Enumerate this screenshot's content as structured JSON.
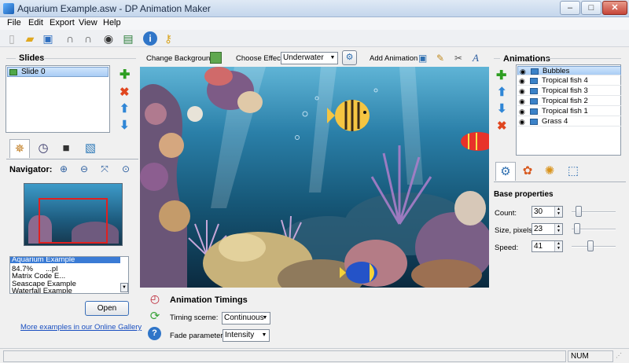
{
  "window": {
    "title": "Aquarium Example.asw - DP Animation Maker",
    "minimize": "–",
    "maximize": "□",
    "close": "✕"
  },
  "menu": [
    "File",
    "Edit",
    "Export",
    "View",
    "Help"
  ],
  "toolbar": {
    "icons": [
      "new-icon",
      "open-folder-icon",
      "save-icon",
      "undo-icon",
      "redo-icon",
      "preview-eye-icon",
      "publish-icon",
      "info-icon",
      "key-icon"
    ]
  },
  "slides": {
    "title": "Slides",
    "items": [
      "Slide 0"
    ]
  },
  "navigator": {
    "label": "Navigator:",
    "zoom": "84.7%",
    "examples": [
      "Aquarium Example",
      "...pl",
      "Matrix Code E...",
      "Seascape Example",
      "Waterfall Example"
    ],
    "open_button": "Open",
    "gallery_link": "More examples in our Online Gallery"
  },
  "canvas_toolbar": {
    "change_background": "Change Background",
    "choose_effect_label": "Choose Effect:",
    "effect_value": "Underwater",
    "add_animation": "Add Animation"
  },
  "timings": {
    "title": "Animation Timings",
    "scheme_label": "Timing sceme:",
    "scheme_value": "Continuous",
    "fade_label": "Fade parameter:",
    "fade_value": "Intensity"
  },
  "animations": {
    "title": "Animations",
    "items": [
      "Bubbles",
      "Tropical fish 4",
      "Tropical fish 3",
      "Tropical fish 2",
      "Tropical fish 1",
      "Grass 4"
    ]
  },
  "base_properties": {
    "title": "Base properties",
    "count_label": "Count:",
    "count_value": "30",
    "count_level": 0.1,
    "size_label": "Size, pixels:",
    "size_value": "23",
    "size_level": 0.06,
    "speed_label": "Speed:",
    "speed_value": "41",
    "speed_level": 0.41
  },
  "status": {
    "num": "NUM"
  },
  "colors": {
    "accent": "#3a7bd5",
    "selection": "#a9cdf5",
    "water_top": "#2a7fa8",
    "water_bottom": "#0b2a3f"
  }
}
